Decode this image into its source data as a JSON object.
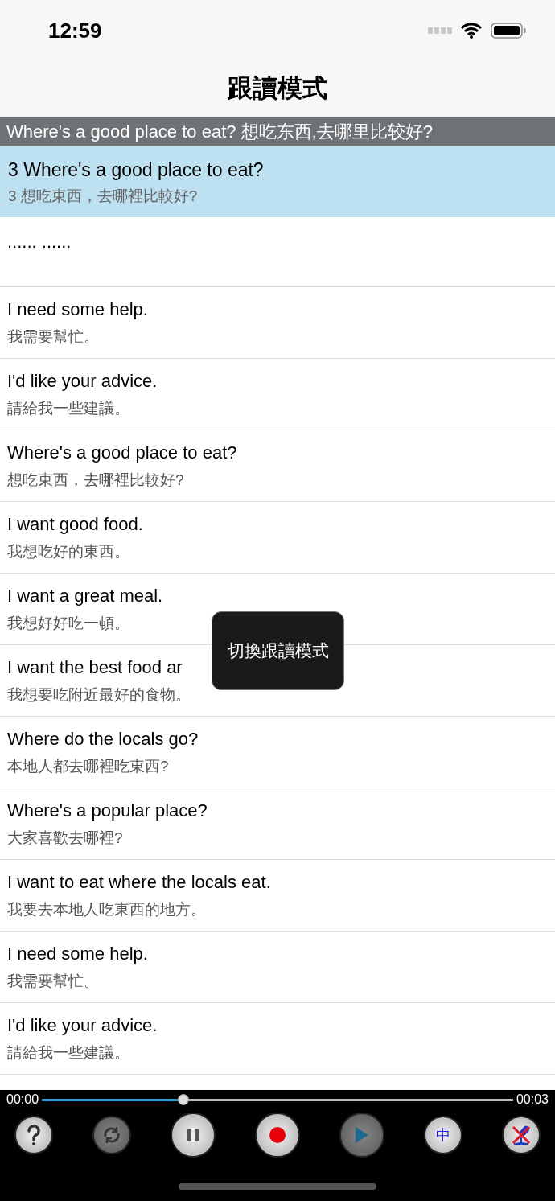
{
  "status_bar": {
    "time": "12:59"
  },
  "nav": {
    "title": "跟讀模式"
  },
  "banner": {
    "text": "Where's a good place to eat? 想吃东西,去哪里比较好?"
  },
  "current": {
    "english": "3 Where's a good place to eat?",
    "chinese": "3 想吃東西，去哪裡比較好?"
  },
  "placeholder_row": {
    "text": "...... ......"
  },
  "rows": [
    {
      "english": "I need some help.",
      "chinese": "我需要幫忙。"
    },
    {
      "english": "I'd like your advice.",
      "chinese": "請給我一些建議。"
    },
    {
      "english": "Where's a good place to eat?",
      "chinese": "想吃東西，去哪裡比較好?"
    },
    {
      "english": "I want good food.",
      "chinese": "我想吃好的東西。"
    },
    {
      "english": "I want a great meal.",
      "chinese": "我想好好吃一頓。"
    },
    {
      "english": "I want the best food ar",
      "chinese": "我想要吃附近最好的食物。"
    },
    {
      "english": "Where do the locals go?",
      "chinese": "本地人都去哪裡吃東西?"
    },
    {
      "english": "Where's a popular place?",
      "chinese": "大家喜歡去哪裡?"
    },
    {
      "english": "I want to eat where the locals eat.",
      "chinese": "我要去本地人吃東西的地方。"
    },
    {
      "english": "I need some help.",
      "chinese": "我需要幫忙。"
    },
    {
      "english": "I'd like your advice.",
      "chinese": "請給我一些建議。"
    }
  ],
  "toast": {
    "text": "切換跟讀模式"
  },
  "player": {
    "elapsed": "00:00",
    "total": "00:03",
    "level": 0.3,
    "buttons": [
      {
        "kind": "help",
        "disabled": false
      },
      {
        "kind": "repeat",
        "disabled": true
      },
      {
        "kind": "pause",
        "disabled": false
      },
      {
        "kind": "record",
        "disabled": false
      },
      {
        "kind": "play",
        "disabled": true
      },
      {
        "kind": "language",
        "label": "中",
        "disabled": false
      },
      {
        "kind": "mic-off",
        "disabled": false
      }
    ]
  }
}
